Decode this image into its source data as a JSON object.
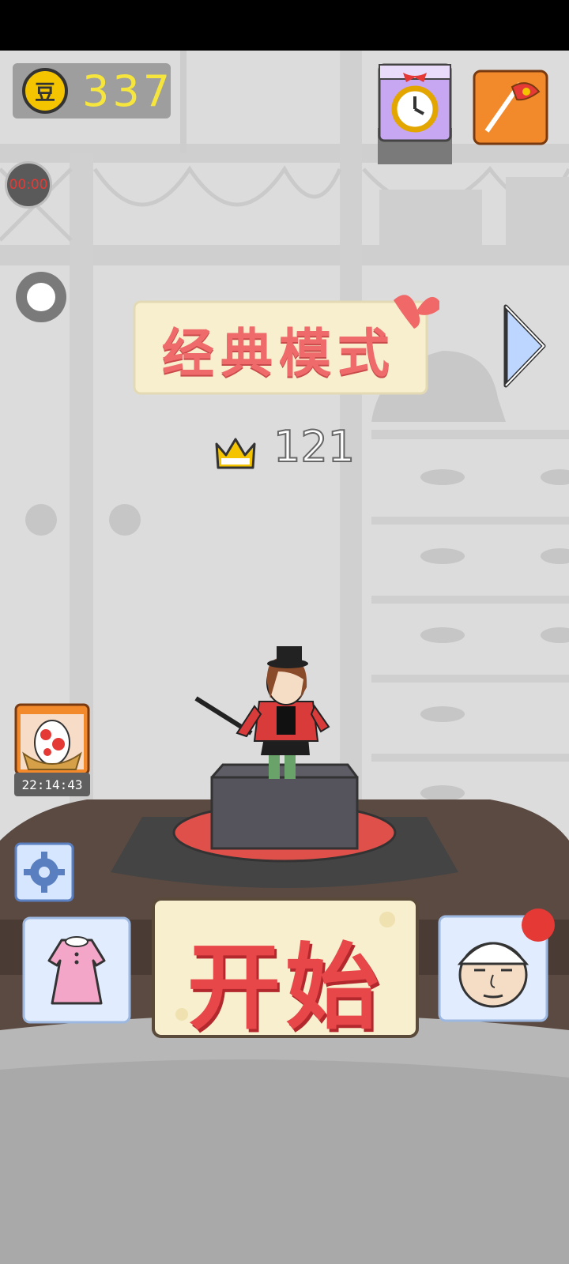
{
  "hud": {
    "coin_icon_glyph": "豆",
    "coin_count": "337",
    "timer_text": "00:00"
  },
  "mode": {
    "title": "经典模式"
  },
  "score": {
    "best": "121"
  },
  "egg": {
    "countdown": "22:14:43"
  },
  "start": {
    "label": "开始"
  },
  "icons": {
    "coin": "coin-icon",
    "timer": "timer-icon",
    "record": "record-icon",
    "clock_gift": "alarm-clock-icon",
    "flag": "flag-icon",
    "next": "chevron-right-icon",
    "crown": "crown-icon",
    "egg": "egg-nest-icon",
    "settings": "gear-icon",
    "dress": "dress-icon",
    "character": "uncle-face-icon"
  },
  "colors": {
    "coin_text": "#f6e53d",
    "accent_red": "#e8474a",
    "banner_cream": "#f7efcd",
    "crown_gold": "#f4c400",
    "notification": "#e53935"
  }
}
